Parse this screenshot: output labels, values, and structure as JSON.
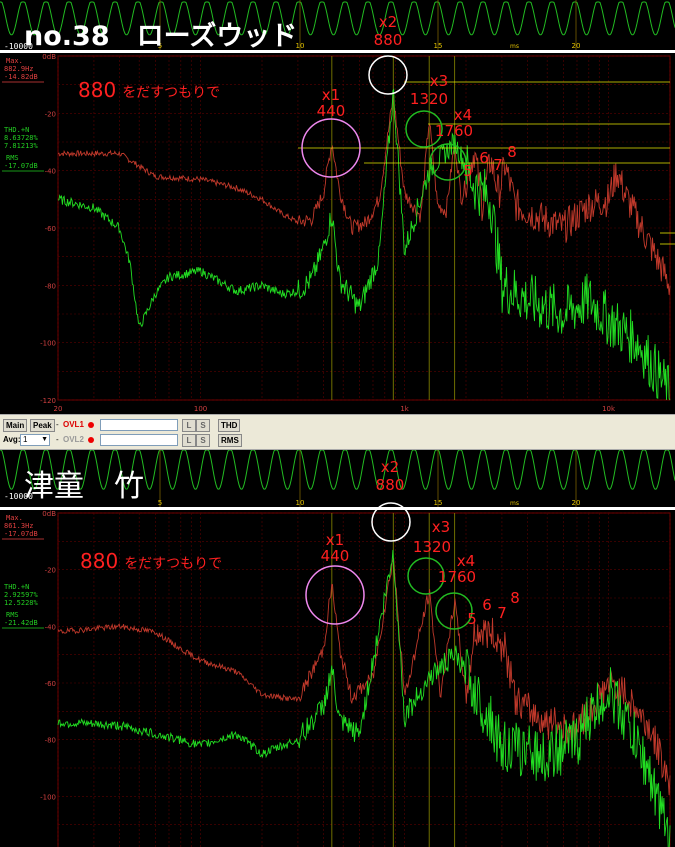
{
  "top": {
    "title": "no.38　ローズウッド",
    "scope_left_label": "-10000",
    "scope_ticks": [
      "5",
      "10",
      "15",
      "20"
    ],
    "scope_unit": "ms",
    "max_label": "Max.",
    "max_freq": "882.9Hz",
    "max_level": "-14.82dB",
    "thd_label": "THD.+N",
    "thd_1": "8.63728%",
    "thd_2": "7.81213%",
    "rms_label": "RMS",
    "rms_value": "-17.07dB",
    "note": "880 をだすつもりで",
    "note_num": "880",
    "note_text": "をだすつもりで"
  },
  "bottom": {
    "title": "津童　竹",
    "scope_left_label": "-10000",
    "scope_ticks": [
      "5",
      "10",
      "15",
      "20"
    ],
    "scope_unit": "ms",
    "max_label": "Max.",
    "max_freq": "861.3Hz",
    "max_level": "-17.07dB",
    "thd_label": "THD.+N",
    "thd_1": "2.92597%",
    "thd_2": "12.5228%",
    "rms_label": "RMS",
    "rms_value": "-21.42dB",
    "note": "880 をだすつもりで",
    "note_num": "880",
    "note_text": "をだすつもりで"
  },
  "annotations": {
    "x1": "x1",
    "x1_freq": "440",
    "x2": "x2",
    "x2_freq": "880",
    "x3": "x3",
    "x3_freq": "1320",
    "x4": "x4",
    "x4_freq": "1760",
    "h5": "5",
    "h6": "6",
    "h7": "7",
    "h8": "8"
  },
  "controls": {
    "main": "Main",
    "peak": "Peak",
    "dash": "-",
    "ovl1": "OVL1",
    "ovl2": "OVL2",
    "avg_label": "Avg:",
    "avg_value": "1",
    "l_btn": "L",
    "s_btn": "S",
    "thd_btn": "THD",
    "rms_btn": "RMS"
  },
  "chart_data": [
    {
      "type": "line",
      "title": "no.38　ローズウッド",
      "x_scale": "log",
      "xlim": [
        20,
        20000
      ],
      "x_ticks": [
        "20",
        "100",
        "1k",
        "10k"
      ],
      "ylim": [
        -120,
        0
      ],
      "y_ticks": [
        "0dB",
        "-20",
        "-40",
        "-60",
        "-80",
        "-100",
        "-120"
      ],
      "grid": true,
      "series": [
        {
          "color": "#c0392b",
          "points": [
            [
              20,
              -34
            ],
            [
              40,
              -34
            ],
            [
              60,
              -42
            ],
            [
              100,
              -43
            ],
            [
              150,
              -46
            ],
            [
              200,
              -50
            ],
            [
              250,
              -55
            ],
            [
              300,
              -58
            ],
            [
              350,
              -57
            ],
            [
              400,
              -48
            ],
            [
              440,
              -30
            ],
            [
              480,
              -47
            ],
            [
              550,
              -60
            ],
            [
              650,
              -58
            ],
            [
              750,
              -50
            ],
            [
              880,
              -14
            ],
            [
              1000,
              -48
            ],
            [
              1200,
              -56
            ],
            [
              1320,
              -22
            ],
            [
              1450,
              -52
            ],
            [
              1600,
              -54
            ],
            [
              1760,
              -30
            ],
            [
              1900,
              -50
            ],
            [
              2200,
              -33
            ],
            [
              2400,
              -52
            ],
            [
              2640,
              -36
            ],
            [
              2900,
              -48
            ],
            [
              3100,
              -38
            ],
            [
              3500,
              -52
            ],
            [
              4500,
              -56
            ],
            [
              6000,
              -60
            ],
            [
              8000,
              -52
            ],
            [
              10000,
              -50
            ],
            [
              11000,
              -40
            ],
            [
              12000,
              -48
            ],
            [
              15000,
              -62
            ],
            [
              20000,
              -80
            ]
          ]
        },
        {
          "color": "#22dd22",
          "points": [
            [
              20,
              -50
            ],
            [
              30,
              -53
            ],
            [
              40,
              -60
            ],
            [
              45,
              -72
            ],
            [
              50,
              -95
            ],
            [
              60,
              -83
            ],
            [
              70,
              -77
            ],
            [
              100,
              -75
            ],
            [
              150,
              -82
            ],
            [
              200,
              -80
            ],
            [
              250,
              -83
            ],
            [
              300,
              -82
            ],
            [
              350,
              -78
            ],
            [
              400,
              -67
            ],
            [
              440,
              -55
            ],
            [
              480,
              -78
            ],
            [
              600,
              -88
            ],
            [
              750,
              -70
            ],
            [
              880,
              -12
            ],
            [
              1000,
              -68
            ],
            [
              1320,
              -40
            ],
            [
              1760,
              -30
            ],
            [
              2200,
              -45
            ],
            [
              2640,
              -50
            ],
            [
              3000,
              -80
            ],
            [
              4000,
              -85
            ],
            [
              6000,
              -90
            ],
            [
              8000,
              -85
            ],
            [
              10000,
              -92
            ],
            [
              14000,
              -100
            ],
            [
              20000,
              -118
            ]
          ]
        }
      ]
    },
    {
      "type": "line",
      "title": "津童　竹",
      "x_scale": "log",
      "xlim": [
        20,
        20000
      ],
      "ylim": [
        -120,
        0
      ],
      "y_ticks": [
        "0dB",
        "-20",
        "-40",
        "-60",
        "-80",
        "-100"
      ],
      "grid": true,
      "series": [
        {
          "color": "#c0392b",
          "points": [
            [
              20,
              -42
            ],
            [
              40,
              -40
            ],
            [
              60,
              -42
            ],
            [
              80,
              -48
            ],
            [
              100,
              -52
            ],
            [
              150,
              -56
            ],
            [
              200,
              -64
            ],
            [
              300,
              -66
            ],
            [
              400,
              -48
            ],
            [
              440,
              -25
            ],
            [
              480,
              -48
            ],
            [
              550,
              -65
            ],
            [
              700,
              -58
            ],
            [
              880,
              -15
            ],
            [
              1000,
              -65
            ],
            [
              1320,
              -28
            ],
            [
              1500,
              -64
            ],
            [
              1760,
              -31
            ],
            [
              2000,
              -65
            ],
            [
              2200,
              -42
            ],
            [
              2640,
              -42
            ],
            [
              3100,
              -48
            ],
            [
              3500,
              -66
            ],
            [
              5000,
              -74
            ],
            [
              7000,
              -76
            ],
            [
              10000,
              -60
            ],
            [
              12000,
              -64
            ],
            [
              16000,
              -76
            ],
            [
              20000,
              -95
            ]
          ]
        },
        {
          "color": "#22dd22",
          "points": [
            [
              20,
              -74
            ],
            [
              40,
              -75
            ],
            [
              60,
              -78
            ],
            [
              100,
              -82
            ],
            [
              150,
              -78
            ],
            [
              200,
              -85
            ],
            [
              300,
              -80
            ],
            [
              400,
              -68
            ],
            [
              440,
              -55
            ],
            [
              480,
              -74
            ],
            [
              600,
              -78
            ],
            [
              880,
              -14
            ],
            [
              1000,
              -72
            ],
            [
              1320,
              -58
            ],
            [
              1760,
              -50
            ],
            [
              2200,
              -62
            ],
            [
              3000,
              -82
            ],
            [
              5000,
              -86
            ],
            [
              7000,
              -80
            ],
            [
              10000,
              -62
            ],
            [
              12000,
              -72
            ],
            [
              16000,
              -92
            ],
            [
              20000,
              -118
            ]
          ]
        }
      ]
    }
  ]
}
